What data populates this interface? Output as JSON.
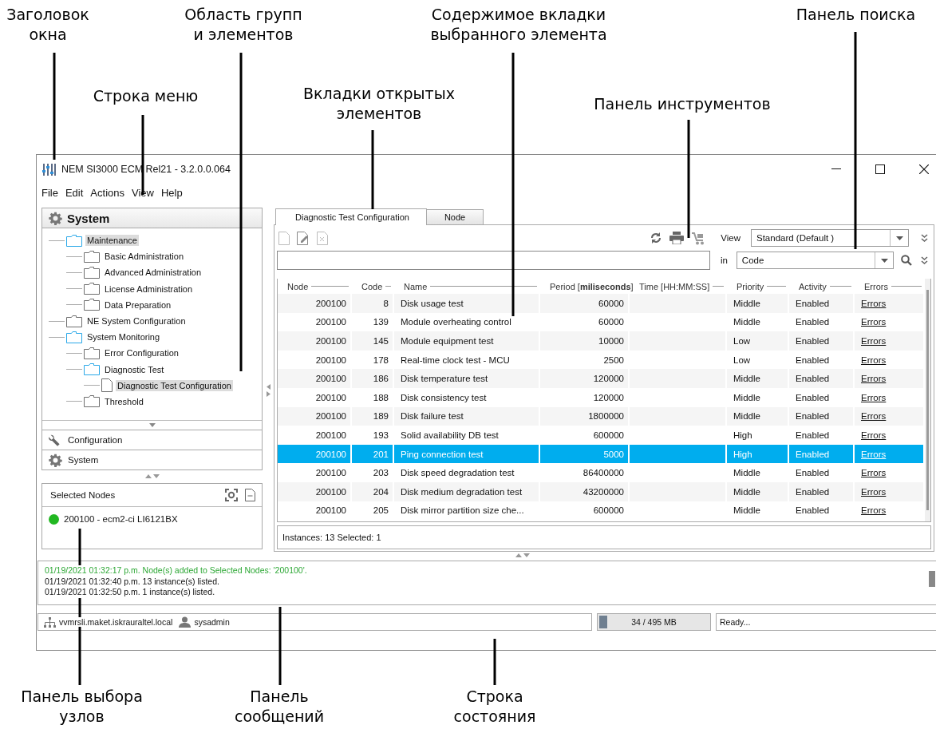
{
  "callouts": [
    {
      "lines": [
        "Заголовок",
        "окна"
      ]
    },
    {
      "lines": [
        "Область групп",
        "и элементов"
      ]
    },
    {
      "lines": [
        "Строка меню"
      ]
    },
    {
      "lines": [
        "Содержимое вкладки",
        "выбранного элемента"
      ]
    },
    {
      "lines": [
        "Панель поиска"
      ]
    },
    {
      "lines": [
        "Вкладки открытых",
        "элементов"
      ]
    },
    {
      "lines": [
        "Панель инструментов"
      ]
    },
    {
      "lines": [
        "Панель выбора",
        "узлов"
      ]
    },
    {
      "lines": [
        "Панель",
        "сообщений"
      ]
    },
    {
      "lines": [
        "Строка",
        "состояния"
      ]
    }
  ],
  "window": {
    "title": "NEM SI3000 ECM Rel21  - 3.2.0.0.064"
  },
  "menu": [
    "File",
    "Edit",
    "Actions",
    "View",
    "Help"
  ],
  "navigator": {
    "header": "System",
    "tree": [
      {
        "label": "Maintenance",
        "kind": "folder",
        "expanded": true,
        "selected": true,
        "children": [
          {
            "label": "Basic Administration",
            "kind": "folder",
            "expanded": false,
            "selected": false
          },
          {
            "label": "Advanced Administration",
            "kind": "folder",
            "expanded": false,
            "selected": false
          },
          {
            "label": "License Administration",
            "kind": "folder",
            "expanded": false,
            "selected": false
          },
          {
            "label": "Data Preparation",
            "kind": "folder",
            "expanded": false,
            "selected": false
          }
        ]
      },
      {
        "label": "NE System Configuration",
        "kind": "folder",
        "expanded": false,
        "selected": false
      },
      {
        "label": "System Monitoring",
        "kind": "folder",
        "expanded": true,
        "selected": false,
        "children": [
          {
            "label": "Error Configuration",
            "kind": "folder",
            "expanded": false,
            "selected": false
          },
          {
            "label": "Diagnostic Test",
            "kind": "folder",
            "expanded": true,
            "selected": false,
            "children": [
              {
                "label": "Diagnostic Test Configuration",
                "kind": "document",
                "selected": true
              }
            ]
          },
          {
            "label": "Threshold",
            "kind": "folder",
            "expanded": false,
            "selected": false
          }
        ]
      }
    ],
    "groups": [
      {
        "label": "Configuration",
        "kind": "wrench"
      },
      {
        "label": "System",
        "kind": "gear"
      }
    ]
  },
  "selected_nodes": {
    "title": "Selected Nodes",
    "nodes": [
      {
        "label": "200100 - ecm2-ci LI6121BX",
        "color": "#22b822"
      }
    ]
  },
  "tabs": [
    {
      "label": "Diagnostic Test Configuration",
      "selected": true
    },
    {
      "label": "Node",
      "selected": false
    }
  ],
  "toolbar": {
    "view_label": "View",
    "view_value": "Standard (Default )"
  },
  "search": {
    "in_label": "in",
    "field": "Code"
  },
  "table": {
    "columns": [
      {
        "label": "Node",
        "kind": "number"
      },
      {
        "label": "Code",
        "kind": "number"
      },
      {
        "label": "Name",
        "kind": "text"
      },
      {
        "label": "Period [**miliseconds**]",
        "kind": "number"
      },
      {
        "label": "Time [HH:MM:SS]",
        "kind": "text"
      },
      {
        "label": "Priority",
        "kind": "text"
      },
      {
        "label": "Activity",
        "kind": "text"
      },
      {
        "label": "Errors",
        "kind": "link"
      }
    ],
    "rows": [
      {
        "cells": [
          "200100",
          "8",
          "Disk usage test",
          "60000",
          "",
          "Middle",
          "Enabled",
          "Errors"
        ],
        "selected": false
      },
      {
        "cells": [
          "200100",
          "139",
          "Module overheating control",
          "60000",
          "",
          "Middle",
          "Enabled",
          "Errors"
        ],
        "selected": false
      },
      {
        "cells": [
          "200100",
          "145",
          "Module equipment test",
          "10000",
          "",
          "Low",
          "Enabled",
          "Errors"
        ],
        "selected": false
      },
      {
        "cells": [
          "200100",
          "178",
          "Real-time clock test - MCU",
          "2500",
          "",
          "Low",
          "Enabled",
          "Errors"
        ],
        "selected": false
      },
      {
        "cells": [
          "200100",
          "186",
          "Disk temperature test",
          "120000",
          "",
          "Middle",
          "Enabled",
          "Errors"
        ],
        "selected": false
      },
      {
        "cells": [
          "200100",
          "188",
          "Disk consistency test",
          "120000",
          "",
          "Middle",
          "Enabled",
          "Errors"
        ],
        "selected": false
      },
      {
        "cells": [
          "200100",
          "189",
          "Disk failure test",
          "1800000",
          "",
          "Middle",
          "Enabled",
          "Errors"
        ],
        "selected": false
      },
      {
        "cells": [
          "200100",
          "193",
          "Solid availability DB test",
          "600000",
          "",
          "High",
          "Enabled",
          "Errors"
        ],
        "selected": false
      },
      {
        "cells": [
          "200100",
          "201",
          "Ping connection test",
          "5000",
          "",
          "High",
          "Enabled",
          "Errors"
        ],
        "selected": true
      },
      {
        "cells": [
          "200100",
          "203",
          "Disk speed degradation test",
          "86400000",
          "",
          "Middle",
          "Enabled",
          "Errors"
        ],
        "selected": false
      },
      {
        "cells": [
          "200100",
          "204",
          "Disk medium degradation test",
          "43200000",
          "",
          "Middle",
          "Enabled",
          "Errors"
        ],
        "selected": false
      },
      {
        "cells": [
          "200100",
          "205",
          "Disk mirror partition size che...",
          "600000",
          "",
          "Middle",
          "Enabled",
          "Errors"
        ],
        "selected": false
      }
    ],
    "footer": "Instances: 13 Selected: 1"
  },
  "messages": [
    {
      "text": "01/19/2021 01:32:17 p.m.  Node(s) added to Selected Nodes: '200100'.",
      "kind": "success"
    },
    {
      "text": "01/19/2021 01:32:40 p.m.  13 instance(s) listed.",
      "kind": "normal"
    },
    {
      "text": "01/19/2021 01:32:50 p.m.  1 instance(s) listed.",
      "kind": "normal"
    }
  ],
  "status_bar": {
    "host": "vvmrsli.maket.iskrauraltel.local",
    "user": "sysadmin",
    "memory": {
      "text": "34 / 495 MB",
      "level": 0.07
    },
    "status": "Ready..."
  }
}
